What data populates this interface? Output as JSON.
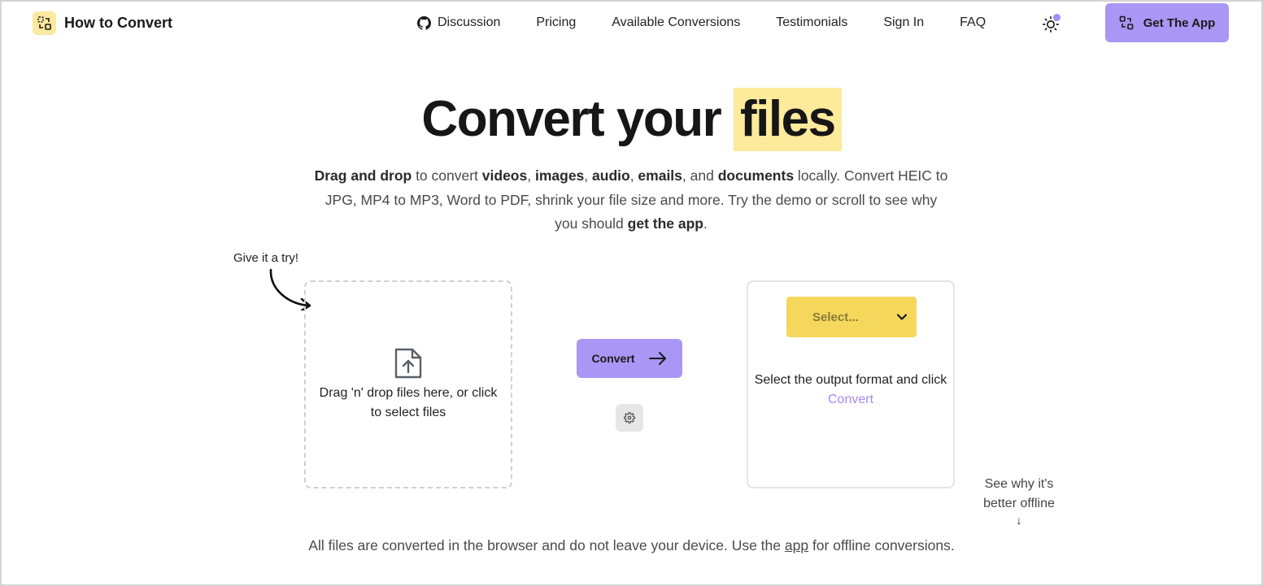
{
  "header": {
    "logo_text": "How to Convert",
    "nav": [
      {
        "label": "Discussion",
        "icon": "github-icon"
      },
      {
        "label": "Pricing"
      },
      {
        "label": "Available Conversions"
      },
      {
        "label": "Testimonials"
      },
      {
        "label": "Sign In"
      },
      {
        "label": "FAQ"
      }
    ],
    "cta_label": "Get The App"
  },
  "hero": {
    "title_prefix": "Convert your",
    "title_highlight": "files",
    "subtitle": {
      "s1": "Drag and drop",
      "s2": " to convert ",
      "s3": "videos",
      "s4": ", ",
      "s5": "images",
      "s6": ", ",
      "s7": "audio",
      "s8": ", ",
      "s9": "emails",
      "s10": ", and ",
      "s11": "documents",
      "s12": " locally. Convert HEIC to JPG, MP4 to MP3, Word to PDF, shrink your file size and more. Try the demo or scroll to see why you should ",
      "s13": "get the app",
      "s14": "."
    }
  },
  "demo": {
    "hint": "Give it a try!",
    "dropzone_text": "Drag 'n' drop files here, or click to select files",
    "convert_label": "Convert",
    "select_placeholder": "Select...",
    "output_text_1": "Select the output format and click ",
    "output_link": "Convert"
  },
  "side": {
    "see_why": "See why it's better offline",
    "arrow": "↓"
  },
  "footer": {
    "note_prefix": "All files are converted in the browser and do not leave your device. Use the ",
    "note_link": "app",
    "note_suffix": " for offline conversions."
  },
  "colors": {
    "accent": "#a996f5",
    "highlight": "#fdea9b",
    "select_bg": "#f5d75c"
  }
}
